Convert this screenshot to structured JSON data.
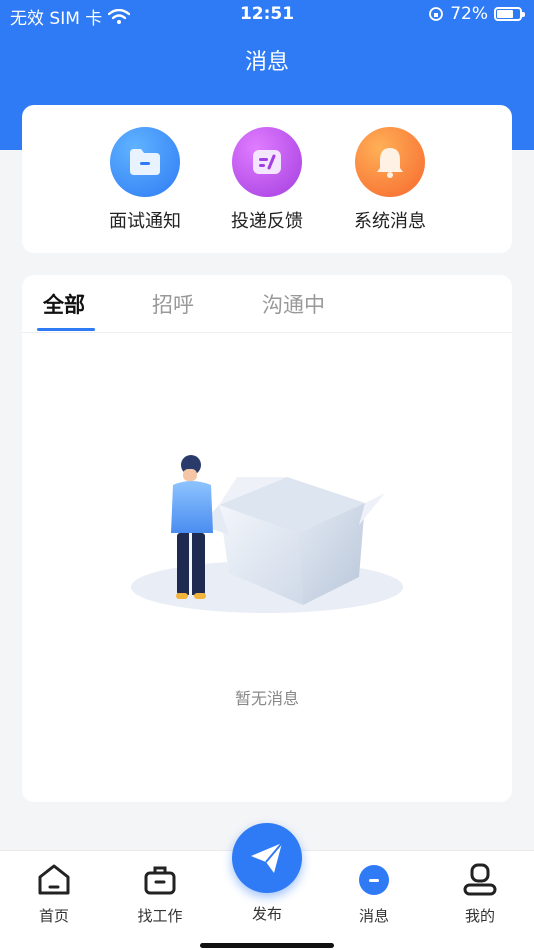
{
  "status_bar": {
    "carrier": "无效 SIM 卡",
    "time": "12:51",
    "battery_percent": "72%",
    "battery_level": 0.72
  },
  "header": {
    "title": "消息"
  },
  "categories": [
    {
      "label": "面试通知",
      "icon": "folder-icon",
      "color": "#2f8cf7"
    },
    {
      "label": "投递反馈",
      "icon": "edit-note-icon",
      "color": "#b34ce8"
    },
    {
      "label": "系统消息",
      "icon": "bell-icon",
      "color": "#fb7a36"
    }
  ],
  "tabs": [
    {
      "label": "全部",
      "active": true
    },
    {
      "label": "招呼",
      "active": false
    },
    {
      "label": "沟通中",
      "active": false
    }
  ],
  "empty_state": {
    "text": "暂无消息",
    "icon": "empty-box-illustration"
  },
  "bottom_nav": {
    "home": "首页",
    "jobs": "找工作",
    "publish": "发布",
    "messages": "消息",
    "mine": "我的"
  },
  "colors": {
    "primary": "#2f7bf5",
    "background": "#f4f5f7"
  }
}
